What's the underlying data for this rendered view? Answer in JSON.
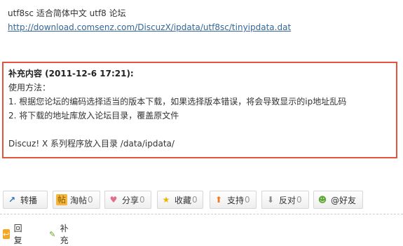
{
  "post": {
    "line1": "utf8sc 适合简体中文 utf8 论坛",
    "link": "http://download.comsenz.com/DiscuzX/ipdata/utf8sc/tinyipdata.dat"
  },
  "supplement": {
    "title": "补充内容 (2011-12-6 17:21):",
    "lines": [
      "使用方法：",
      "1. 根据您论坛的编码选择适当的版本下载，如果选择版本错误，将会导致显示的ip地址乱码",
      "2. 将下载的地址库放入论坛目录，覆盖原文件",
      "",
      "Discuz! X 系列程序放入目录 /data/ipdata/"
    ]
  },
  "actions": {
    "forward": {
      "label": "转播",
      "icon": "forward-icon"
    },
    "post": {
      "label": "淘帖",
      "count": "0",
      "icon": "post-icon"
    },
    "share": {
      "label": "分享",
      "count": "0",
      "icon": "heart-icon"
    },
    "favorite": {
      "label": "收藏",
      "count": "0",
      "icon": "star-icon"
    },
    "support": {
      "label": "支持",
      "count": "0",
      "icon": "arrow-up-icon"
    },
    "oppose": {
      "label": "反对",
      "count": "0",
      "icon": "arrow-down-icon"
    },
    "friends": {
      "label": "@好友",
      "icon": "friends-icon"
    }
  },
  "bottom": {
    "reply": "回复",
    "supplement": "补充"
  },
  "colors": {
    "box_border": "#e3543f",
    "link": "#336699"
  }
}
